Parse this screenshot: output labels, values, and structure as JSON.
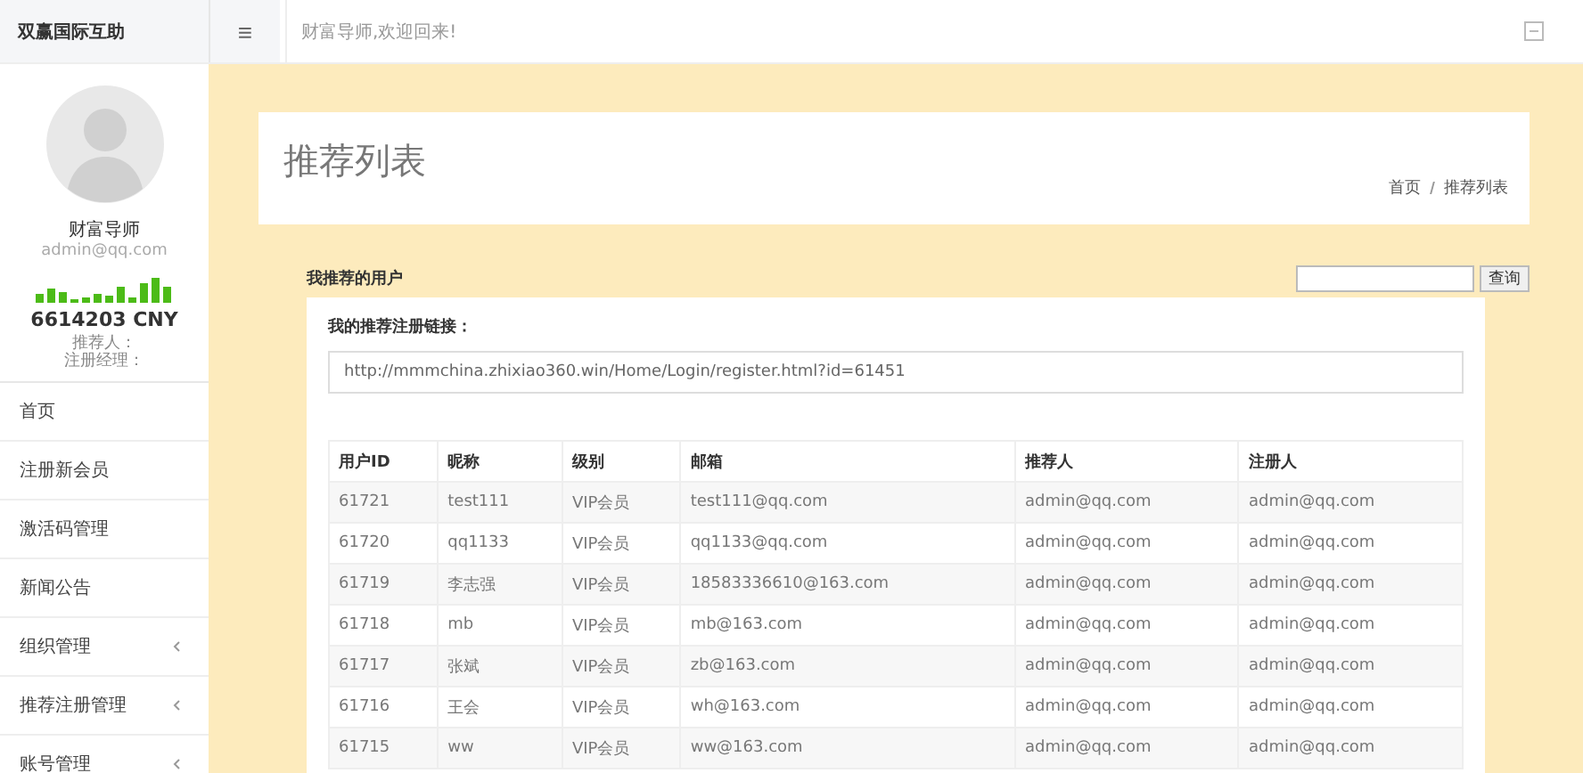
{
  "header": {
    "logo": "双赢国际互助",
    "menu_icon": "≡",
    "welcome": "财富导师,欢迎回来!"
  },
  "profile": {
    "name": "财富导师",
    "email": "admin@qq.com",
    "balance": "6614203 CNY",
    "referrer": "推荐人：",
    "manager": "注册经理："
  },
  "sidebar": {
    "items": [
      {
        "label": "首页",
        "has_submenu": false
      },
      {
        "label": "注册新会员",
        "has_submenu": false
      },
      {
        "label": "激活码管理",
        "has_submenu": false
      },
      {
        "label": "新闻公告",
        "has_submenu": false
      },
      {
        "label": "组织管理",
        "has_submenu": true
      },
      {
        "label": "推荐注册管理",
        "has_submenu": true
      },
      {
        "label": "账号管理",
        "has_submenu": true
      }
    ]
  },
  "page": {
    "title": "推荐列表",
    "breadcrumb": [
      "首页",
      "推荐列表"
    ]
  },
  "search": {
    "label": "我推荐的用户",
    "button": "查询"
  },
  "link": {
    "label": "我的推荐注册链接：",
    "value": "http://mmmchina.zhixiao360.win/Home/Login/register.html?id=61451"
  },
  "table": {
    "columns": [
      "用户ID",
      "昵称",
      "级别",
      "邮箱",
      "推荐人",
      "注册人"
    ],
    "rows": [
      [
        "61721",
        "test111",
        "VIP会员",
        "test111@qq.com",
        "admin@qq.com",
        "admin@qq.com"
      ],
      [
        "61720",
        "qq1133",
        "VIP会员",
        "qq1133@qq.com",
        "admin@qq.com",
        "admin@qq.com"
      ],
      [
        "61719",
        "李志强",
        "VIP会员",
        "18583336610@163.com",
        "admin@qq.com",
        "admin@qq.com"
      ],
      [
        "61718",
        "mb",
        "VIP会员",
        "mb@163.com",
        "admin@qq.com",
        "admin@qq.com"
      ],
      [
        "61717",
        "张斌",
        "VIP会员",
        "zb@163.com",
        "admin@qq.com",
        "admin@qq.com"
      ],
      [
        "61716",
        "王会",
        "VIP会员",
        "wh@163.com",
        "admin@qq.com",
        "admin@qq.com"
      ],
      [
        "61715",
        "ww",
        "VIP会员",
        "ww@163.com",
        "admin@qq.com",
        "admin@qq.com"
      ]
    ]
  }
}
